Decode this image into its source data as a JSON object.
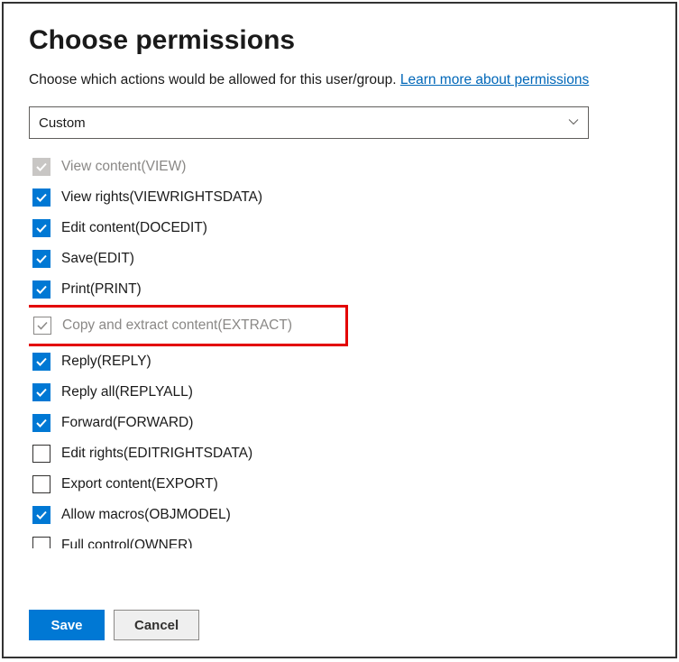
{
  "title": "Choose permissions",
  "subtitle": "Choose which actions would be allowed for this user/group. ",
  "learn_link": "Learn more about permissions",
  "dropdown": {
    "selected": "Custom"
  },
  "permissions": [
    {
      "label": "View content(VIEW)",
      "state": "disabled_checked",
      "highlight": false
    },
    {
      "label": "View rights(VIEWRIGHTSDATA)",
      "state": "checked",
      "highlight": false
    },
    {
      "label": "Edit content(DOCEDIT)",
      "state": "checked",
      "highlight": false
    },
    {
      "label": "Save(EDIT)",
      "state": "checked",
      "highlight": false
    },
    {
      "label": "Print(PRINT)",
      "state": "checked",
      "highlight": false
    },
    {
      "label": "Copy and extract content(EXTRACT)",
      "state": "unchecked_grey",
      "highlight": true
    },
    {
      "label": "Reply(REPLY)",
      "state": "checked",
      "highlight": false
    },
    {
      "label": "Reply all(REPLYALL)",
      "state": "checked",
      "highlight": false
    },
    {
      "label": "Forward(FORWARD)",
      "state": "checked",
      "highlight": false
    },
    {
      "label": "Edit rights(EDITRIGHTSDATA)",
      "state": "unchecked",
      "highlight": false
    },
    {
      "label": "Export content(EXPORT)",
      "state": "unchecked",
      "highlight": false
    },
    {
      "label": "Allow macros(OBJMODEL)",
      "state": "checked",
      "highlight": false
    },
    {
      "label": "Full control(OWNER)",
      "state": "unchecked",
      "highlight": false,
      "cutoff": true
    }
  ],
  "buttons": {
    "save": "Save",
    "cancel": "Cancel"
  }
}
